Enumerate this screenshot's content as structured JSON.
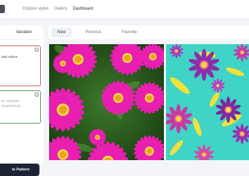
{
  "topbar": {
    "nav": [
      "Explore styles",
      "Gallery",
      "Dashboard"
    ],
    "active": "Dashboard"
  },
  "left_panel": {
    "tab_label": "Variation",
    "field_a": {
      "text_line1": "rant colors",
      "text_line2": ""
    },
    "field_b": {
      "placeholder_line1": "for example",
      "placeholder_line2": "symmetrical..."
    },
    "create_button": "te Pattern"
  },
  "gallery": {
    "tabs": [
      "New",
      "Previous",
      "Favorite"
    ],
    "active_tab": "New",
    "images": [
      {
        "name": "pink-daisy-photo",
        "subject": "magenta gerbera daisies with orange centers on green foliage"
      },
      {
        "name": "floral-pattern-illustration",
        "subject": "purple and pink flowers with yellow leaves on teal background"
      }
    ]
  },
  "colors": {
    "accent_dark": "#1c2334",
    "error_border": "#c95858",
    "success_border": "#4d9a4f",
    "page_bg": "#f3f5f8"
  }
}
